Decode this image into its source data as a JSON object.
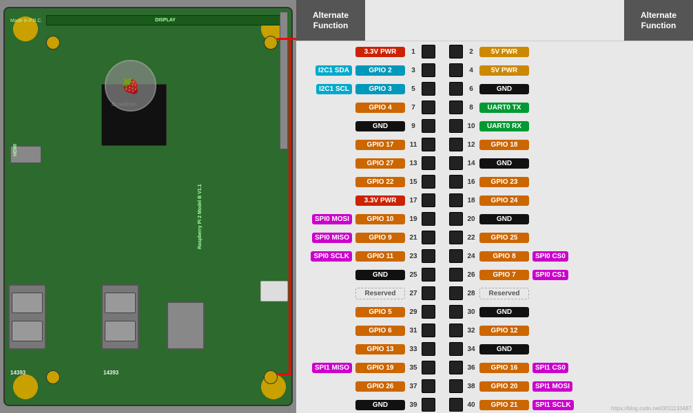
{
  "header": {
    "alt_func_label": "Alternate\nFunction",
    "alt_func_left": "Alternate Function",
    "alt_func_right": "Alternate Function"
  },
  "pins": [
    {
      "left_alt": "",
      "left_label": "3.3V PWR",
      "left_num": "1",
      "right_num": "2",
      "right_label": "5V PWR",
      "right_alt": "",
      "left_color": "red-pin",
      "right_color": "yellow-pin"
    },
    {
      "left_alt": "I2C1 SDA",
      "left_label": "GPIO 2",
      "left_num": "3",
      "right_num": "4",
      "right_label": "5V PWR",
      "right_alt": "",
      "left_color": "cyan-pin",
      "right_color": "yellow-pin"
    },
    {
      "left_alt": "I2C1 SCL",
      "left_label": "GPIO 3",
      "left_num": "5",
      "right_num": "6",
      "right_label": "GND",
      "right_alt": "",
      "left_color": "cyan-pin",
      "right_color": "black-pin"
    },
    {
      "left_alt": "",
      "left_label": "GPIO 4",
      "left_num": "7",
      "right_num": "8",
      "right_label": "UART0 TX",
      "right_alt": "",
      "left_color": "orange-pin",
      "right_color": "green-pin"
    },
    {
      "left_alt": "",
      "left_label": "GND",
      "left_num": "9",
      "right_num": "10",
      "right_label": "UART0 RX",
      "right_alt": "",
      "left_color": "black-pin",
      "right_color": "green-pin"
    },
    {
      "left_alt": "",
      "left_label": "GPIO 17",
      "left_num": "11",
      "right_num": "12",
      "right_label": "GPIO 18",
      "right_alt": "",
      "left_color": "orange-pin",
      "right_color": "orange-pin"
    },
    {
      "left_alt": "",
      "left_label": "GPIO 27",
      "left_num": "13",
      "right_num": "14",
      "right_label": "GND",
      "right_alt": "",
      "left_color": "orange-pin",
      "right_color": "black-pin"
    },
    {
      "left_alt": "",
      "left_label": "GPIO 22",
      "left_num": "15",
      "right_num": "16",
      "right_label": "GPIO 23",
      "right_alt": "",
      "left_color": "orange-pin",
      "right_color": "orange-pin"
    },
    {
      "left_alt": "",
      "left_label": "3.3V PWR",
      "left_num": "17",
      "right_num": "18",
      "right_label": "GPIO 24",
      "right_alt": "",
      "left_color": "red-pin",
      "right_color": "orange-pin"
    },
    {
      "left_alt": "SPI0 MOSI",
      "left_label": "GPIO 10",
      "left_num": "19",
      "right_num": "20",
      "right_label": "GND",
      "right_alt": "",
      "left_color": "orange-pin",
      "right_color": "black-pin"
    },
    {
      "left_alt": "SPI0 MISO",
      "left_label": "GPIO 9",
      "left_num": "21",
      "right_num": "22",
      "right_label": "GPIO 25",
      "right_alt": "",
      "left_color": "orange-pin",
      "right_color": "orange-pin"
    },
    {
      "left_alt": "SPI0 SCLK",
      "left_label": "GPIO 11",
      "left_num": "23",
      "right_num": "24",
      "right_label": "GPIO 8",
      "right_alt": "SPI0 CS0",
      "left_color": "orange-pin",
      "right_color": "orange-pin"
    },
    {
      "left_alt": "",
      "left_label": "GND",
      "left_num": "25",
      "right_num": "26",
      "right_label": "GPIO 7",
      "right_alt": "SPI0 CS1",
      "left_color": "black-pin",
      "right_color": "orange-pin"
    },
    {
      "left_alt": "",
      "left_label": "Reserved",
      "left_num": "27",
      "right_num": "28",
      "right_label": "Reserved",
      "right_alt": "",
      "left_color": "empty-pin",
      "right_color": "empty-pin"
    },
    {
      "left_alt": "",
      "left_label": "GPIO 5",
      "left_num": "29",
      "right_num": "30",
      "right_label": "GND",
      "right_alt": "",
      "left_color": "orange-pin",
      "right_color": "black-pin"
    },
    {
      "left_alt": "",
      "left_label": "GPIO 6",
      "left_num": "31",
      "right_num": "32",
      "right_label": "GPIO 12",
      "right_alt": "",
      "left_color": "orange-pin",
      "right_color": "orange-pin"
    },
    {
      "left_alt": "",
      "left_label": "GPIO 13",
      "left_num": "33",
      "right_num": "34",
      "right_label": "GND",
      "right_alt": "",
      "left_color": "orange-pin",
      "right_color": "black-pin"
    },
    {
      "left_alt": "SPI1 MISO",
      "left_label": "GPIO 19",
      "left_num": "35",
      "right_num": "36",
      "right_label": "GPIO 16",
      "right_alt": "SPI1 CS0",
      "left_color": "orange-pin",
      "right_color": "orange-pin"
    },
    {
      "left_alt": "",
      "left_label": "GPIO 26",
      "left_num": "37",
      "right_num": "38",
      "right_label": "GPIO 20",
      "right_alt": "SPI1 MOSI",
      "left_color": "orange-pin",
      "right_color": "orange-pin"
    },
    {
      "left_alt": "",
      "left_label": "GND",
      "left_num": "39",
      "right_num": "40",
      "right_label": "GPIO 21",
      "right_alt": "SPI1 SCLK",
      "left_color": "black-pin",
      "right_color": "orange-pin"
    }
  ],
  "watermark": "https://blog.csdn.net/0011133487"
}
